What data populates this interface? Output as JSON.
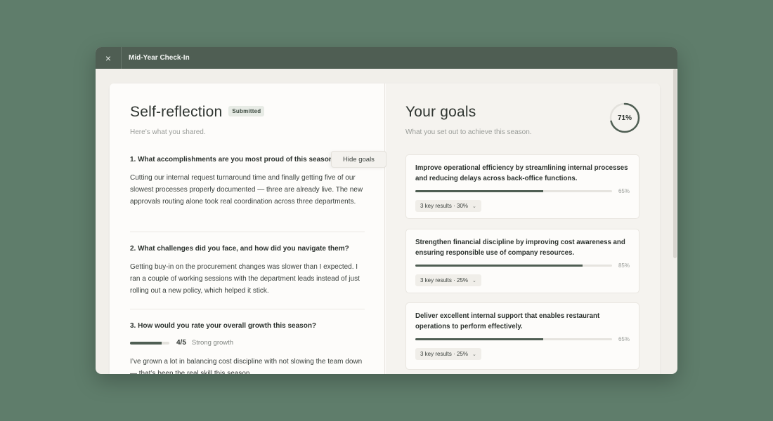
{
  "window": {
    "title": "Mid-Year Check-In",
    "close_icon": "×"
  },
  "reflection": {
    "title": "Self-reflection",
    "badge": "Submitted",
    "subtitle": "Here’s what you shared.",
    "questions": [
      {
        "title": "1. What accomplishments are you most proud of this season?",
        "body": "Cutting our internal request turnaround time and finally getting five of our slowest processes properly documented — three are already live. The new approvals routing alone took real coordination across three departments."
      },
      {
        "title": "2. What challenges did you face, and how did you navigate them?",
        "body": "Getting buy-in on the procurement changes was slower than I expected. I ran a couple of working sessions with the department leads instead of just rolling out a new policy, which helped it stick."
      },
      {
        "title": "3. How would you rate your overall growth this season?",
        "rating_value": "4/5",
        "rating_fraction": 0.8,
        "rating_label": "Strong growth",
        "body": "I’ve grown a lot in balancing cost discipline with not slowing the team down — that’s been the real skill this season."
      }
    ]
  },
  "hide_goals_label": "Hide goals",
  "goals": {
    "title": "Your goals",
    "subtitle": "What you set out to achieve this season.",
    "overall_progress": "71%",
    "overall_fraction": 0.71,
    "items": [
      {
        "title": "Improve operational efficiency by streamlining internal processes and reducing delays across back-office functions.",
        "progress": "65%",
        "fraction": 0.65,
        "key_results": "3 key results · 30%"
      },
      {
        "title": "Strengthen financial discipline by improving cost awareness and ensuring responsible use of company resources.",
        "progress": "85%",
        "fraction": 0.85,
        "key_results": "3 key results · 25%"
      },
      {
        "title": "Deliver excellent internal support that enables restaurant operations to perform effectively.",
        "progress": "65%",
        "fraction": 0.65,
        "key_results": "3 key results · 25%"
      }
    ]
  },
  "colors": {
    "accent": "#4f5e53",
    "background": "#5f7d6b",
    "window_bg": "#f1efea"
  }
}
